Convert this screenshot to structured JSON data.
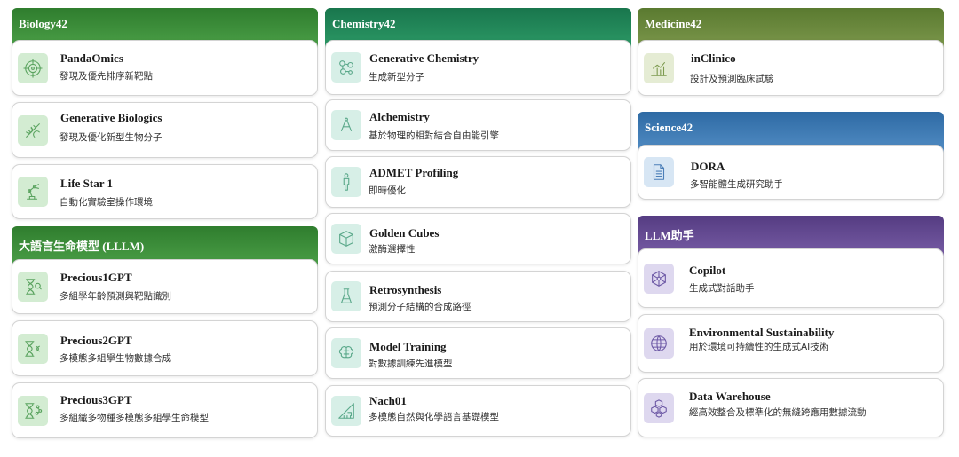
{
  "colors": {
    "biology_header": "#3d8f3a",
    "chemistry_header": "#1f8a5a",
    "medicine_header": "#6b8a3c",
    "science_header": "#3f7bb3",
    "llm_header": "#6a4f96"
  },
  "biology": {
    "header": "Biology42",
    "items": [
      {
        "title": "PandaOmics",
        "subtitle": "發現及優先排序新靶點",
        "icon": "target-icon"
      },
      {
        "title": "Generative Biologics",
        "subtitle": "發現及優化新型生物分子",
        "icon": "dna-icon"
      },
      {
        "title": "Life Star 1",
        "subtitle": "自動化實驗室操作環境",
        "icon": "robot-arm-icon"
      }
    ]
  },
  "lllm": {
    "header": "大語言生命模型 (LLLM)",
    "items": [
      {
        "title": "Precious1GPT",
        "subtitle": "多組學年齡預測與靶點識別",
        "icon": "hourglass-search-icon"
      },
      {
        "title": "Precious2GPT",
        "subtitle": "多模態多組學生物數據合成",
        "icon": "hourglass-dna-icon"
      },
      {
        "title": "Precious3GPT",
        "subtitle": "多組織多物種多模態多組學生命模型",
        "icon": "hourglass-network-icon"
      }
    ]
  },
  "chemistry": {
    "header": "Chemistry42",
    "items": [
      {
        "title": "Generative Chemistry",
        "subtitle": "生成新型分子",
        "icon": "molecule-icon"
      },
      {
        "title": "Alchemistry",
        "subtitle": "基於物理的相對結合自由能引擎",
        "icon": "compass-icon"
      },
      {
        "title": "ADMET Profiling",
        "subtitle": "即時優化",
        "icon": "human-figure-icon"
      },
      {
        "title": "Golden Cubes",
        "subtitle": "激酶選擇性",
        "icon": "cube-icon"
      },
      {
        "title": "Retrosynthesis",
        "subtitle": "預測分子結構的合成路徑",
        "icon": "flask-icon"
      },
      {
        "title": "Model Training",
        "subtitle": "對數據訓練先進模型",
        "icon": "brain-icon"
      },
      {
        "title": "Nach01",
        "subtitle": "多模態自然與化學語言基礎模型",
        "icon": "ruler-triangle-icon"
      }
    ]
  },
  "medicine": {
    "header": "Medicine42",
    "items": [
      {
        "title": "inClinico",
        "subtitle": "設計及預測臨床試驗",
        "icon": "bar-chart-icon"
      }
    ]
  },
  "science": {
    "header": "Science42",
    "items": [
      {
        "title": "DORA",
        "subtitle": "多智能體生成研究助手",
        "icon": "document-icon"
      }
    ]
  },
  "llm": {
    "header": "LLM助手",
    "items": [
      {
        "title": "Copilot",
        "subtitle": "生成式對話助手",
        "icon": "network-hexagon-icon"
      },
      {
        "title": "Environmental Sustainability",
        "subtitle": "用於環境可持續性的生成式AI技術",
        "icon": "globe-icon"
      },
      {
        "title": "Data Warehouse",
        "subtitle": "經高效整合及標準化的無縫跨應用數據流動",
        "icon": "cubes-stack-icon"
      }
    ]
  }
}
